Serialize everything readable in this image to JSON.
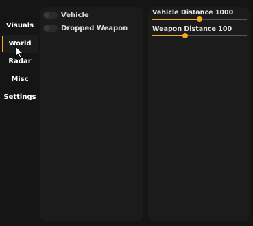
{
  "sidebar": {
    "items": [
      {
        "label": "Visuals"
      },
      {
        "label": "World",
        "active": true
      },
      {
        "label": "Radar"
      },
      {
        "label": "Misc"
      },
      {
        "label": "Settings"
      }
    ]
  },
  "toggles": [
    {
      "label": "Vehicle",
      "enabled": false
    },
    {
      "label": "Dropped Weapon",
      "enabled": false
    }
  ],
  "sliders": [
    {
      "label": "Vehicle Distance 1000",
      "fraction": 0.5
    },
    {
      "label": "Weapon Distance 100",
      "fraction": 0.35
    }
  ],
  "colors": {
    "accent": "#f5a623",
    "background": "#151515",
    "panel": "#1b1b1b",
    "text": "#e6e6e6"
  },
  "icons": {
    "cursor": "mouse-pointer-icon"
  }
}
